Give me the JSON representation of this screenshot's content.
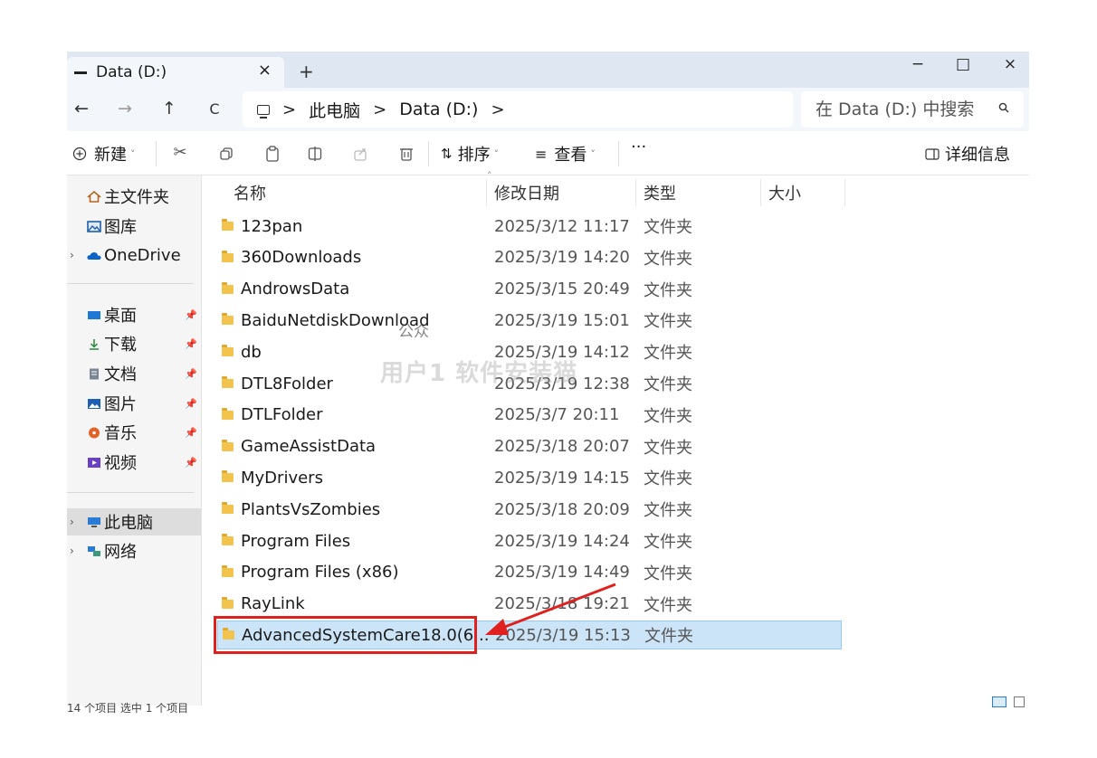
{
  "tab": {
    "title": "Data (D:)",
    "close": "×",
    "new": "+"
  },
  "window_controls": {
    "minimize": "−",
    "maximize": "□",
    "close": "×"
  },
  "nav": {
    "back": "←",
    "forward": "→",
    "up": "↑",
    "refresh": "C"
  },
  "breadcrumb": {
    "sep": ">",
    "items": [
      "此电脑",
      "Data (D:)"
    ]
  },
  "search": {
    "placeholder": "在 Data (D:) 中搜索"
  },
  "commands": {
    "new_label": "新建",
    "sort_label": "排序",
    "view_label": "查看",
    "more": "···",
    "details_label": "详细信息",
    "caret": "˅"
  },
  "sidebar": {
    "top": [
      {
        "label": "主文件夹",
        "icon": "home-icon"
      },
      {
        "label": "图库",
        "icon": "gallery-icon"
      },
      {
        "label": "OneDrive",
        "icon": "cloud-icon"
      }
    ],
    "quick": [
      {
        "label": "桌面",
        "icon": "desktop-icon"
      },
      {
        "label": "下载",
        "icon": "download-icon"
      },
      {
        "label": "文档",
        "icon": "document-icon"
      },
      {
        "label": "图片",
        "icon": "pictures-icon"
      },
      {
        "label": "音乐",
        "icon": "music-icon"
      },
      {
        "label": "视频",
        "icon": "video-icon"
      }
    ],
    "devices": [
      {
        "label": "此电脑",
        "icon": "computer-icon"
      },
      {
        "label": "网络",
        "icon": "network-icon"
      }
    ]
  },
  "columns": {
    "name": "名称",
    "date": "修改日期",
    "type": "类型",
    "size": "大小"
  },
  "files": [
    {
      "name": "123pan",
      "date": "2025/3/12 11:17",
      "type": "文件夹"
    },
    {
      "name": "360Downloads",
      "date": "2025/3/19 14:20",
      "type": "文件夹"
    },
    {
      "name": "AndrowsData",
      "date": "2025/3/15 20:49",
      "type": "文件夹"
    },
    {
      "name": "BaiduNetdiskDownload",
      "date": "2025/3/19 15:01",
      "type": "文件夹"
    },
    {
      "name": "db",
      "date": "2025/3/19 14:12",
      "type": "文件夹"
    },
    {
      "name": "DTL8Folder",
      "date": "2025/3/19 12:38",
      "type": "文件夹"
    },
    {
      "name": "DTLFolder",
      "date": "2025/3/7 20:11",
      "type": "文件夹"
    },
    {
      "name": "GameAssistData",
      "date": "2025/3/18 20:07",
      "type": "文件夹"
    },
    {
      "name": "MyDrivers",
      "date": "2025/3/19 14:15",
      "type": "文件夹"
    },
    {
      "name": "PlantsVsZombies",
      "date": "2025/3/18 20:09",
      "type": "文件夹"
    },
    {
      "name": "Program Files",
      "date": "2025/3/19 14:24",
      "type": "文件夹"
    },
    {
      "name": "Program Files (x86)",
      "date": "2025/3/19 14:49",
      "type": "文件夹"
    },
    {
      "name": "RayLink",
      "date": "2025/3/18 19:21",
      "type": "文件夹"
    },
    {
      "name": "AdvancedSystemCare18.0(6...",
      "date": "2025/3/19 15:13",
      "type": "文件夹",
      "selected": true
    }
  ],
  "watermark": {
    "text": "用户1 软件安装猫",
    "sub": "公众"
  },
  "status": {
    "text": "14 个项目    选中 1 个项目"
  },
  "colors": {
    "accent": "#cce4f7",
    "highlight": "#e0201e",
    "folder": "#f2c44d"
  }
}
